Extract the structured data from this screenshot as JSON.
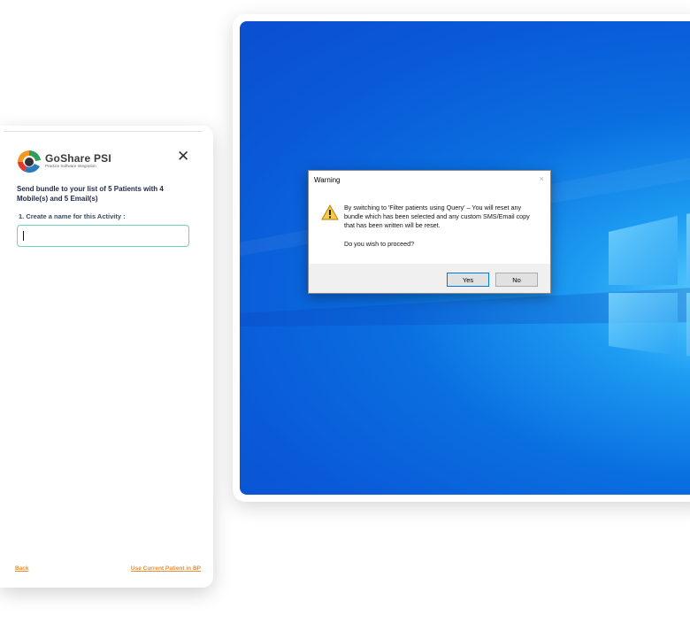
{
  "dialog": {
    "title": "Warning",
    "close_glyph": "×",
    "icon": "warning-triangle-icon",
    "message": "By switching to 'Filter patients using Query' – You will reset any bundle which has been selected and any custom SMS/Email copy that has been written will be reset.",
    "question": "Do you wish to proceed?",
    "yes_label": "Yes",
    "no_label": "No"
  },
  "panel": {
    "logo_name": "GoShare PSI",
    "logo_sub": "Practice Software Integration",
    "close_glyph": "✕",
    "intro": "Send bundle to your list of 5 Patients with 4 Mobile(s) and 5 Email(s)",
    "field_label": "1. Create a name for this Activity :",
    "field_value": "",
    "back_link": "Back",
    "use_current_link": "Use Current Patient in BP"
  },
  "colors": {
    "accent_orange": "#f08b2a",
    "input_border": "#6fd3b6",
    "desktop_blue": "#0a5ad8"
  }
}
